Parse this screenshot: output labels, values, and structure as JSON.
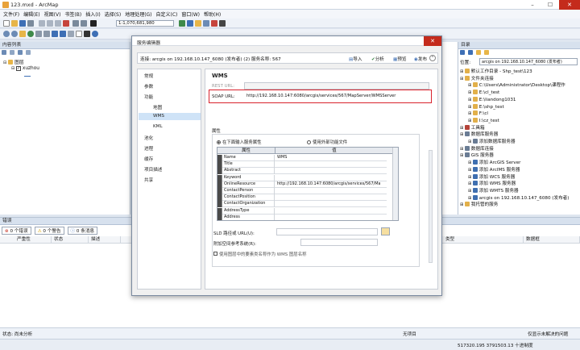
{
  "window": {
    "title": "123.mxd - ArcMap",
    "minimize": "–",
    "maximize": "☐",
    "close": "✕"
  },
  "menu": [
    "文件(F)",
    "编辑(E)",
    "视图(V)",
    "书签(B)",
    "插入(I)",
    "选择(S)",
    "地理处理(G)",
    "自定义(C)",
    "窗口(W)",
    "帮助(H)"
  ],
  "toolbar": {
    "scale": "1:1,070,681,980"
  },
  "toc": {
    "header": "内容列表",
    "layers_root": "图层",
    "layer": "xuzhou"
  },
  "catalog": {
    "header": "目录",
    "location_label": "位置:",
    "location_value": "arcgis on 192.168.10.147_6080 (发布者)",
    "items": [
      {
        "text": "默认工作目录 - Shp_test\\123",
        "indent": 0,
        "color": "#e2b04a"
      },
      {
        "text": "文件夹连接",
        "indent": 0,
        "color": "#e2b04a"
      },
      {
        "text": "C:\\Users\\Administrator\\Desktop\\课程作",
        "indent": 1,
        "color": "#e2b04a"
      },
      {
        "text": "E:\\cl_test",
        "indent": 1,
        "color": "#e2b04a"
      },
      {
        "text": "E:\\liandong1031",
        "indent": 1,
        "color": "#e2b04a"
      },
      {
        "text": "E:\\shp_test",
        "indent": 1,
        "color": "#e2b04a"
      },
      {
        "text": "F:\\cl",
        "indent": 1,
        "color": "#e2b04a"
      },
      {
        "text": "I:\\cz_test",
        "indent": 1,
        "color": "#e2b04a"
      },
      {
        "text": "工具箱",
        "indent": 0,
        "color": "#b5443a"
      },
      {
        "text": "数据库服务器",
        "indent": 0,
        "color": "#6a7c94"
      },
      {
        "text": "添加数据库服务器",
        "indent": 1,
        "color": "#6a7c94"
      },
      {
        "text": "数据库连接",
        "indent": 0,
        "color": "#6a7c94"
      },
      {
        "text": "GIS 服务器",
        "indent": 0,
        "color": "#6a7c94"
      },
      {
        "text": "添加 ArcGIS Server",
        "indent": 1,
        "color": "#3f6fb0"
      },
      {
        "text": "添加 ArcIMS 服务器",
        "indent": 1,
        "color": "#3f6fb0"
      },
      {
        "text": "添加 WCS 服务器",
        "indent": 1,
        "color": "#3f6fb0"
      },
      {
        "text": "添加 WMS 服务器",
        "indent": 1,
        "color": "#3f6fb0"
      },
      {
        "text": "添加 WMTS 服务器",
        "indent": 1,
        "color": "#3f6fb0"
      },
      {
        "text": "arcgis on 192.168.10.147_6080 (发布者)",
        "indent": 1,
        "color": "#3f6fb0"
      },
      {
        "text": "我托管的服务",
        "indent": 0,
        "color": "#e2b04a"
      }
    ]
  },
  "dialog": {
    "title": "服务编辑器",
    "connection": "连接: arcgis on 192.168.10.147_6080 (发布者) (2)   服务名称: 567",
    "btn_import": "导入",
    "btn_analyze": "分析",
    "btn_preview": "预览",
    "btn_publish": "发布",
    "nav": [
      "常规",
      "参数",
      "功能",
      "地图",
      "WMS",
      "KML",
      "池化",
      "进程",
      "缓存",
      "项目描述",
      "共享"
    ],
    "section_title": "WMS",
    "rest_label": "REST URL:",
    "soap_label": "SOAP URL:",
    "soap_url": "http://192.168.10.147:6080/arcgis/services/567/MapServer/WMSServer",
    "props_label": "属性",
    "radio_input": "在下面输入服务属性",
    "radio_external": "使用外部功能文件",
    "col_prop": "属性",
    "col_value": "值",
    "rows": [
      {
        "k": "Name",
        "v": "WMS"
      },
      {
        "k": "Title",
        "v": ""
      },
      {
        "k": "Abstract",
        "v": ""
      },
      {
        "k": "Keyword",
        "v": ""
      },
      {
        "k": "OnlineResource",
        "v": "http://192.168.10.147:6080/arcgis/services/567/MapSer"
      },
      {
        "k": "ContactPerson",
        "v": ""
      },
      {
        "k": "ContactPosition",
        "v": ""
      },
      {
        "k": "ContactOrganization",
        "v": ""
      },
      {
        "k": "AddressType",
        "v": ""
      },
      {
        "k": "Address",
        "v": ""
      }
    ],
    "sld_label": "SLD 路径或 URL(U):",
    "crs_label": "附加空间参考系统(R):",
    "more_label": "使用图层中的要素类名称作为 WMS 图层名称"
  },
  "bottom": {
    "header": "错误",
    "errors": "0 个错误",
    "warnings": "0 个警告",
    "messages": "0 条消息",
    "left_cols": [
      "严重性",
      "状态",
      "描述"
    ],
    "right_cols": [
      "类型",
      "数据框"
    ]
  },
  "status": {
    "left": "状态: 尚未分析",
    "mid": "无项目",
    "right": "仅显示未解决的问题",
    "coords": "517320.195  3791503.13 十进制度"
  }
}
